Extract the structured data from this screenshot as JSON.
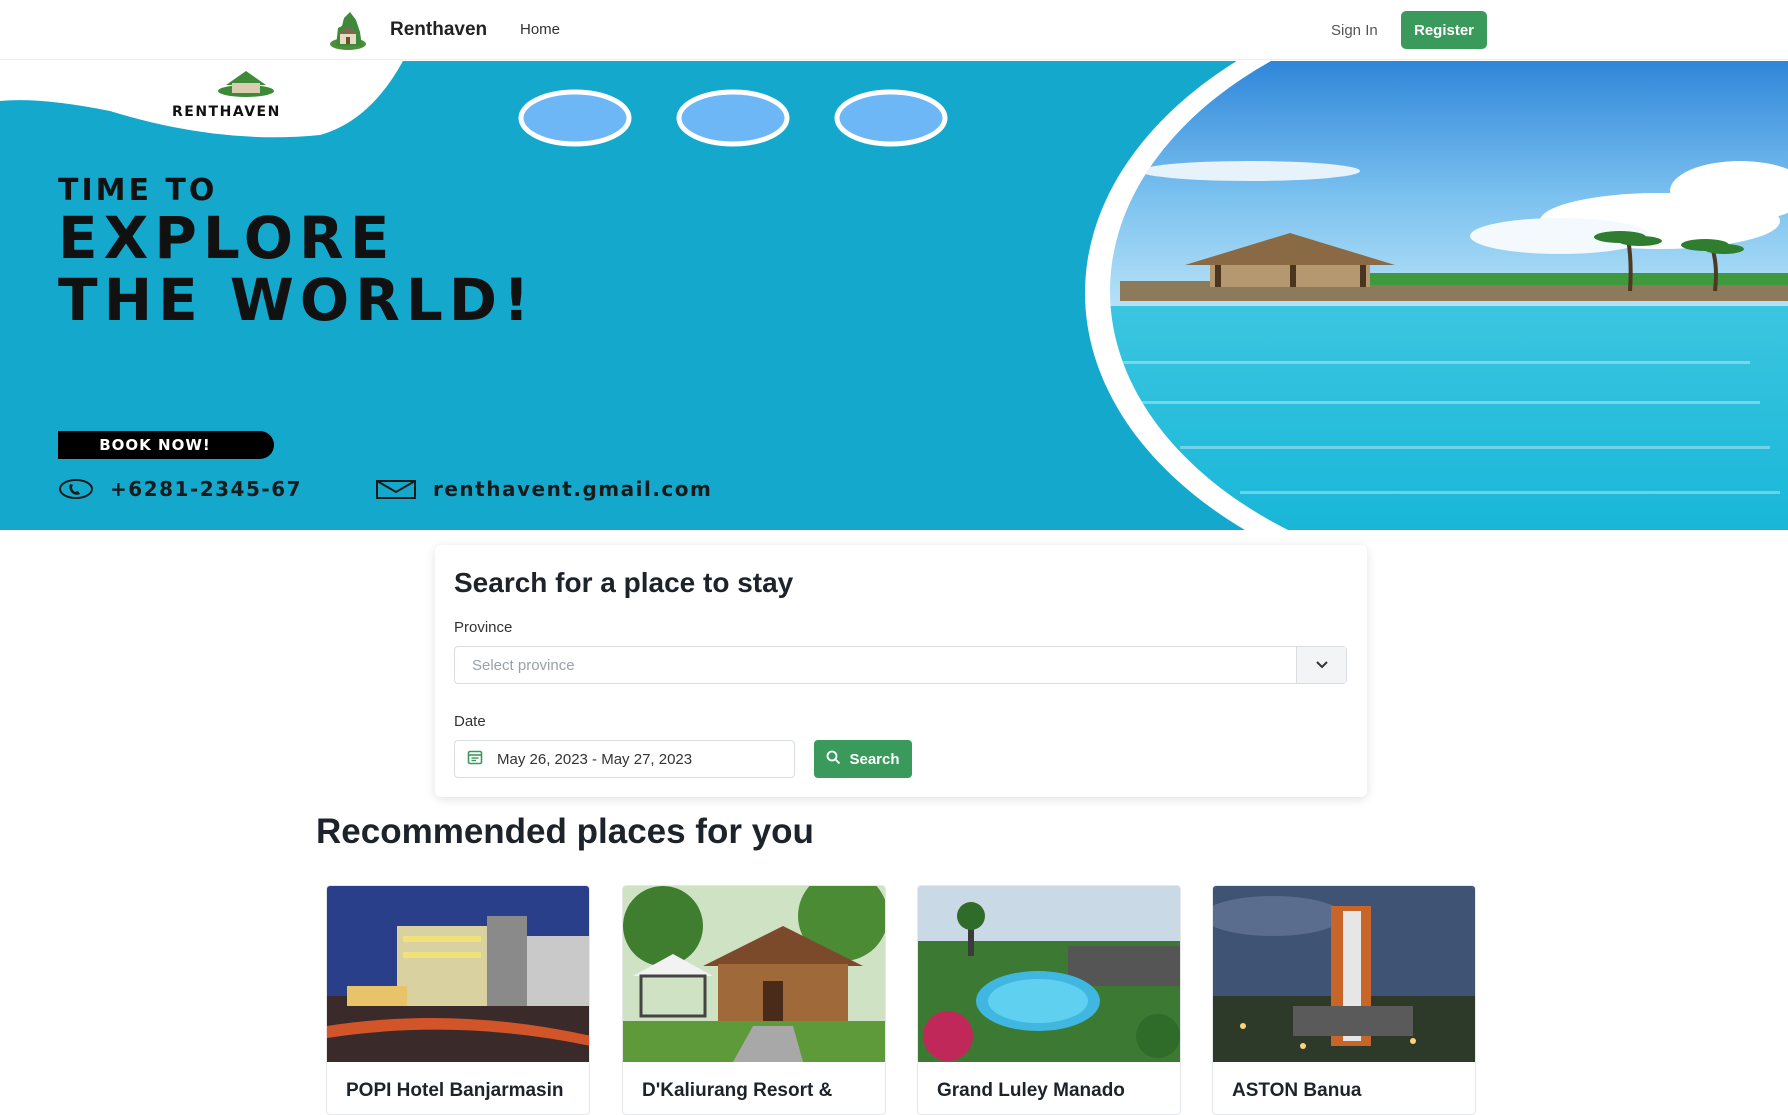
{
  "navbar": {
    "brand_name": "Renthaven",
    "home_label": "Home",
    "signin_label": "Sign In",
    "register_label": "Register"
  },
  "hero": {
    "logo_text": "RENTHAVEN",
    "headline_line1": "TIME TO",
    "headline_line2": "EXPLORE",
    "headline_line3": "THE WORLD!",
    "book_label": "BOOK NOW!",
    "phone": "+6281-2345-67",
    "email": "renthavent.gmail.com"
  },
  "search": {
    "title": "Search for a place to stay",
    "province_label": "Province",
    "province_placeholder": "Select province",
    "date_label": "Date",
    "date_value": "May 26, 2023 - May 27, 2023",
    "search_label": "Search"
  },
  "recommended": {
    "title": "Recommended places for you",
    "places": [
      {
        "name": "POPI Hotel Banjarmasin"
      },
      {
        "name": "D'Kaliurang Resort &"
      },
      {
        "name": "Grand Luley Manado"
      },
      {
        "name": "ASTON Banua"
      }
    ]
  },
  "colors": {
    "accent": "#3a9a5c",
    "hero_bg": "#14a9cc"
  },
  "icons": [
    "house-logo-icon",
    "phone-icon",
    "envelope-icon",
    "chevron-down-icon",
    "calendar-icon",
    "search-icon"
  ]
}
